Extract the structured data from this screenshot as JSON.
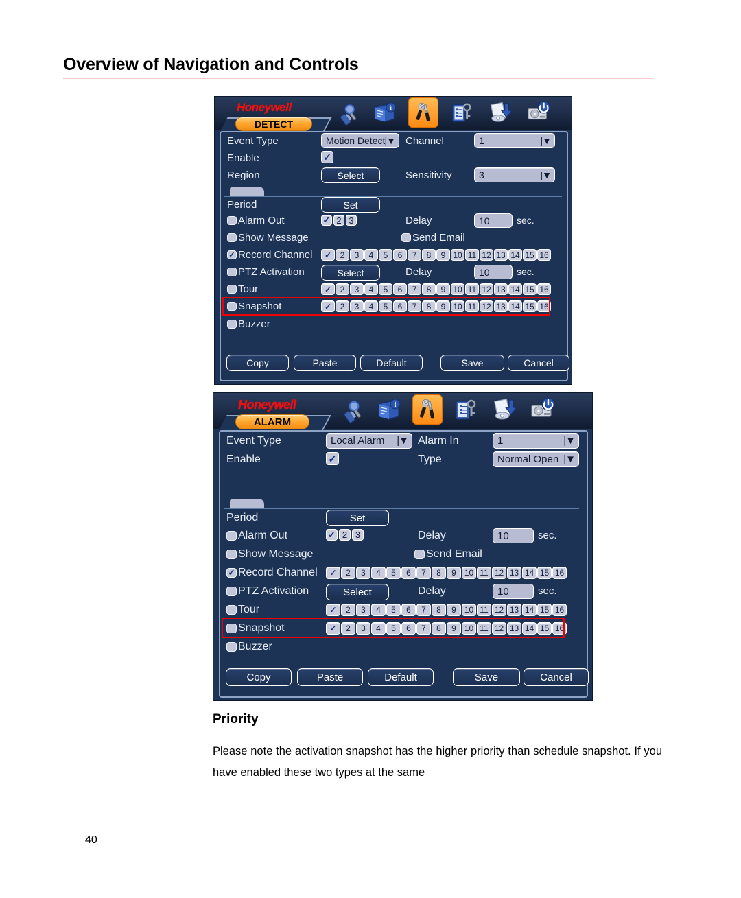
{
  "document": {
    "title": "Overview of Navigation and Controls",
    "page_number": "40",
    "section_heading": "Priority",
    "paragraph": "Please note the activation snapshot has the higher priority than schedule snapshot. If you have enabled these two types at the same"
  },
  "colors": {
    "accent_orange": "#ff9a20",
    "panel_bg": "#1d3356",
    "field_bg": "#b7bcd3",
    "highlight_red": "#ee0000",
    "logo_red": "#ee1111",
    "title_rule": "#f6c9c9"
  },
  "toolbar": {
    "logo": "Honeywell",
    "icons": [
      {
        "name": "search-icon",
        "active": false
      },
      {
        "name": "info-book-icon",
        "active": false
      },
      {
        "name": "settings-tools-icon",
        "active": true
      },
      {
        "name": "account-keys-icon",
        "active": false
      },
      {
        "name": "backup-disk-icon",
        "active": false
      },
      {
        "name": "shutdown-hdd-icon",
        "active": false
      }
    ]
  },
  "detect_panel": {
    "tab_label": "DETECT",
    "event_type_label": "Event Type",
    "event_type_value": "Motion Detect",
    "channel_label": "Channel",
    "channel_value": "1",
    "enable_label": "Enable",
    "enable_checked": true,
    "region_label": "Region",
    "region_button": "Select",
    "sensitivity_label": "Sensitivity",
    "sensitivity_value": "3",
    "period_label": "Period",
    "period_button": "Set",
    "alarm_out_label": "Alarm Out",
    "alarm_out_channels": [
      "1",
      "2",
      "3"
    ],
    "alarm_out_delay_label": "Delay",
    "alarm_out_delay_value": "10",
    "alarm_out_delay_unit": "sec.",
    "show_message_label": "Show Message",
    "send_email_label": "Send Email",
    "record_channel_label": "Record Channel",
    "record_channel_checked": true,
    "ptz_activation_label": "PTZ Activation",
    "ptz_button": "Select",
    "ptz_delay_label": "Delay",
    "ptz_delay_value": "10",
    "ptz_delay_unit": "sec.",
    "tour_label": "Tour",
    "snapshot_label": "Snapshot",
    "buzzer_label": "Buzzer",
    "channels": [
      "1",
      "2",
      "3",
      "4",
      "5",
      "6",
      "7",
      "8",
      "9",
      "10",
      "11",
      "12",
      "13",
      "14",
      "15",
      "16"
    ],
    "buttons": [
      "Copy",
      "Paste",
      "Default",
      "Save",
      "Cancel"
    ]
  },
  "alarm_panel": {
    "tab_label": "ALARM",
    "event_type_label": "Event Type",
    "event_type_value": "Local Alarm",
    "alarm_in_label": "Alarm In",
    "alarm_in_value": "1",
    "enable_label": "Enable",
    "enable_checked": true,
    "type_label": "Type",
    "type_value": "Normal Open",
    "period_label": "Period",
    "period_button": "Set",
    "alarm_out_label": "Alarm Out",
    "alarm_out_channels": [
      "1",
      "2",
      "3"
    ],
    "alarm_out_delay_label": "Delay",
    "alarm_out_delay_value": "10",
    "alarm_out_delay_unit": "sec.",
    "show_message_label": "Show Message",
    "send_email_label": "Send Email",
    "record_channel_label": "Record Channel",
    "record_channel_checked": true,
    "ptz_activation_label": "PTZ Activation",
    "ptz_button": "Select",
    "ptz_delay_label": "Delay",
    "ptz_delay_value": "10",
    "ptz_delay_unit": "sec.",
    "tour_label": "Tour",
    "snapshot_label": "Snapshot",
    "buzzer_label": "Buzzer",
    "channels": [
      "1",
      "2",
      "3",
      "4",
      "5",
      "6",
      "7",
      "8",
      "9",
      "10",
      "11",
      "12",
      "13",
      "14",
      "15",
      "16"
    ],
    "buttons": [
      "Copy",
      "Paste",
      "Default",
      "Save",
      "Cancel"
    ]
  }
}
